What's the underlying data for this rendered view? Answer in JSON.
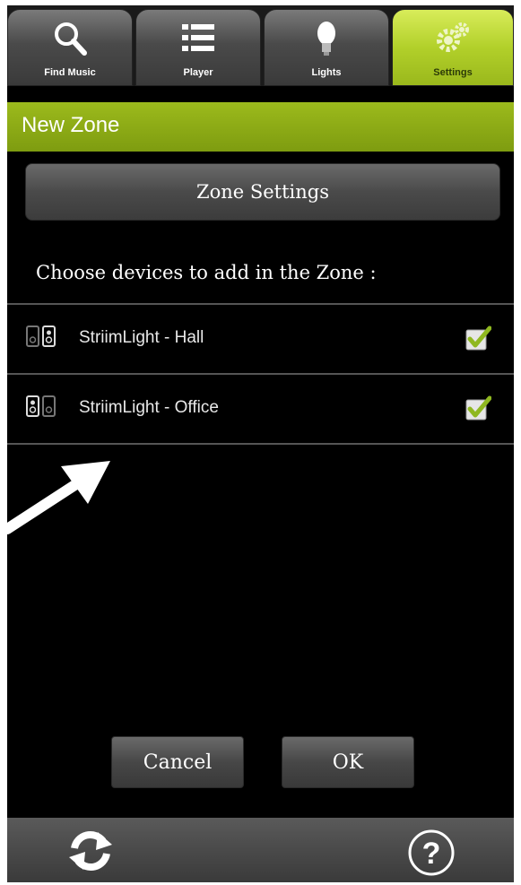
{
  "tabs": [
    {
      "label": "Find Music",
      "icon": "search-icon"
    },
    {
      "label": "Player",
      "icon": "list-icon"
    },
    {
      "label": "Lights",
      "icon": "lightbulb-icon"
    },
    {
      "label": "Settings",
      "icon": "gears-icon",
      "active": true
    }
  ],
  "header": {
    "title": "New Zone"
  },
  "zone_settings_label": "Zone Settings",
  "prompt": "Choose devices to add in the Zone :",
  "devices": [
    {
      "name": "StriimLight - Hall",
      "checked": true,
      "icon": "speaker-pair-icon"
    },
    {
      "name": "StriimLight - Office",
      "checked": true,
      "icon": "speaker-pair-icon"
    }
  ],
  "buttons": {
    "cancel": "Cancel",
    "ok": "OK"
  },
  "bottom_bar": {
    "refresh_icon": "refresh-icon",
    "help_icon": "help-icon"
  },
  "colors": {
    "accent": "#9cba1c",
    "background": "#000000",
    "check": "#8fb820"
  }
}
